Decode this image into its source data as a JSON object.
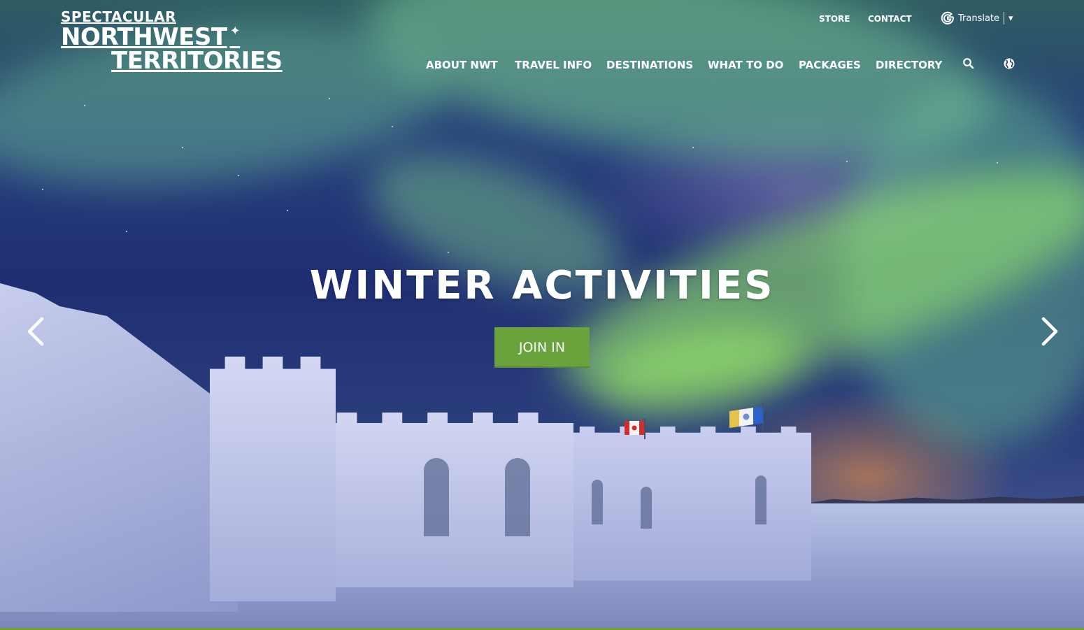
{
  "brand": {
    "logo_top": "SPECTACULAR",
    "logo_mid": "NORTHWEST",
    "logo_bot": "TERRITORIES"
  },
  "utility_nav": {
    "store": "STORE",
    "contact": "CONTACT",
    "translate": "Translate",
    "translate_caret": "▾"
  },
  "main_nav": {
    "items": [
      "ABOUT NWT",
      "TRAVEL INFO",
      "DESTINATIONS",
      "WHAT TO DO",
      "PACKAGES",
      "DIRECTORY"
    ],
    "search_icon": "search-icon",
    "language_icon": "globe-icon"
  },
  "hero": {
    "title": "WINTER ACTIVITIES",
    "cta": "JOIN IN",
    "prev_icon": "chevron-left-icon",
    "next_icon": "chevron-right-icon"
  },
  "colors": {
    "accent_green": "#6aa33c",
    "text": "#ffffff"
  }
}
